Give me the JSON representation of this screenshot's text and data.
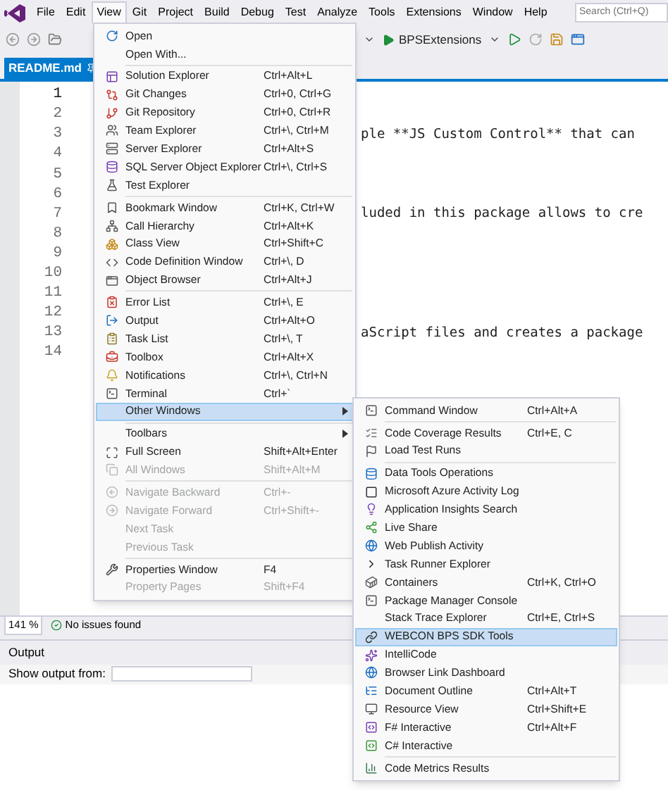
{
  "menu_bar": [
    {
      "label": "File",
      "selected": false
    },
    {
      "label": "Edit",
      "selected": false
    },
    {
      "label": "View",
      "selected": true
    },
    {
      "label": "Git",
      "selected": false
    },
    {
      "label": "Project",
      "selected": false
    },
    {
      "label": "Build",
      "selected": false
    },
    {
      "label": "Debug",
      "selected": false
    },
    {
      "label": "Test",
      "selected": false
    },
    {
      "label": "Analyze",
      "selected": false
    },
    {
      "label": "Tools",
      "selected": false
    },
    {
      "label": "Extensions",
      "selected": false
    },
    {
      "label": "Window",
      "selected": false
    },
    {
      "label": "Help",
      "selected": false
    }
  ],
  "search": {
    "placeholder": "Search (Ctrl+Q)"
  },
  "toolbar": {
    "run_target": "BPSExtensions"
  },
  "tab": {
    "title": "README.md",
    "selected": true
  },
  "editor": {
    "lines": [
      {
        "number": "1",
        "current": true
      },
      {
        "number": "2",
        "current": false
      },
      {
        "number": "3",
        "current": false,
        "text": "ple **JS Custom Control** that can"
      },
      {
        "number": "4",
        "current": false
      },
      {
        "number": "5",
        "current": false
      },
      {
        "number": "6",
        "current": false
      },
      {
        "number": "7",
        "current": false,
        "text": "luded in this package allows to cre"
      },
      {
        "number": "8",
        "current": false
      },
      {
        "number": "9",
        "current": false
      },
      {
        "number": "10",
        "current": false
      },
      {
        "number": "11",
        "current": false
      },
      {
        "number": "12",
        "current": false
      },
      {
        "number": "13",
        "current": false,
        "text": "aScript files and creates a package"
      },
      {
        "number": "14",
        "current": false
      }
    ]
  },
  "status_bar": {
    "zoom": "141 %",
    "issues": "No issues found"
  },
  "output_panel": {
    "title": "Output",
    "show_output_label": "Show output from:"
  },
  "view_menu": [
    {
      "kind": "item",
      "label": "Open",
      "has_icon": true,
      "disabled": false,
      "selected": false,
      "submenu": false
    },
    {
      "kind": "item",
      "label": "Open With...",
      "has_icon": false,
      "disabled": false,
      "selected": false,
      "submenu": false
    },
    {
      "kind": "separator"
    },
    {
      "kind": "item",
      "label": "Solution Explorer",
      "shortcut": "Ctrl+Alt+L",
      "has_icon": true,
      "disabled": false,
      "selected": false,
      "submenu": false
    },
    {
      "kind": "item",
      "label": "Git Changes",
      "shortcut": "Ctrl+0, Ctrl+G",
      "has_icon": true,
      "disabled": false,
      "selected": false,
      "submenu": false
    },
    {
      "kind": "item",
      "label": "Git Repository",
      "shortcut": "Ctrl+0, Ctrl+R",
      "has_icon": true,
      "disabled": false,
      "selected": false,
      "submenu": false
    },
    {
      "kind": "item",
      "label": "Team Explorer",
      "shortcut": "Ctrl+\\, Ctrl+M",
      "has_icon": true,
      "disabled": false,
      "selected": false,
      "submenu": false
    },
    {
      "kind": "item",
      "label": "Server Explorer",
      "shortcut": "Ctrl+Alt+S",
      "has_icon": true,
      "disabled": false,
      "selected": false,
      "submenu": false
    },
    {
      "kind": "item",
      "label": "SQL Server Object Explorer",
      "shortcut": "Ctrl+\\, Ctrl+S",
      "has_icon": true,
      "disabled": false,
      "selected": false,
      "submenu": false
    },
    {
      "kind": "item",
      "label": "Test Explorer",
      "has_icon": true,
      "disabled": false,
      "selected": false,
      "submenu": false
    },
    {
      "kind": "separator"
    },
    {
      "kind": "item",
      "label": "Bookmark Window",
      "shortcut": "Ctrl+K, Ctrl+W",
      "has_icon": true,
      "disabled": false,
      "selected": false,
      "submenu": false
    },
    {
      "kind": "item",
      "label": "Call Hierarchy",
      "shortcut": "Ctrl+Alt+K",
      "has_icon": true,
      "disabled": false,
      "selected": false,
      "submenu": false
    },
    {
      "kind": "item",
      "label": "Class View",
      "shortcut": "Ctrl+Shift+C",
      "has_icon": true,
      "disabled": false,
      "selected": false,
      "submenu": false
    },
    {
      "kind": "item",
      "label": "Code Definition Window",
      "shortcut": "Ctrl+\\, D",
      "has_icon": true,
      "disabled": false,
      "selected": false,
      "submenu": false
    },
    {
      "kind": "item",
      "label": "Object Browser",
      "shortcut": "Ctrl+Alt+J",
      "has_icon": true,
      "disabled": false,
      "selected": false,
      "submenu": false
    },
    {
      "kind": "separator"
    },
    {
      "kind": "item",
      "label": "Error List",
      "shortcut": "Ctrl+\\, E",
      "has_icon": true,
      "disabled": false,
      "selected": false,
      "submenu": false
    },
    {
      "kind": "item",
      "label": "Output",
      "shortcut": "Ctrl+Alt+O",
      "has_icon": true,
      "disabled": false,
      "selected": false,
      "submenu": false
    },
    {
      "kind": "item",
      "label": "Task List",
      "shortcut": "Ctrl+\\, T",
      "has_icon": true,
      "disabled": false,
      "selected": false,
      "submenu": false
    },
    {
      "kind": "item",
      "label": "Toolbox",
      "shortcut": "Ctrl+Alt+X",
      "has_icon": true,
      "disabled": false,
      "selected": false,
      "submenu": false
    },
    {
      "kind": "item",
      "label": "Notifications",
      "shortcut": "Ctrl+\\, Ctrl+N",
      "has_icon": true,
      "disabled": false,
      "selected": false,
      "submenu": false
    },
    {
      "kind": "item",
      "label": "Terminal",
      "shortcut": "Ctrl+`",
      "has_icon": true,
      "disabled": false,
      "selected": false,
      "submenu": false
    },
    {
      "kind": "item",
      "label": "Other Windows",
      "has_icon": false,
      "disabled": false,
      "selected": true,
      "submenu": true
    },
    {
      "kind": "separator"
    },
    {
      "kind": "item",
      "label": "Toolbars",
      "has_icon": false,
      "disabled": false,
      "selected": false,
      "submenu": true
    },
    {
      "kind": "item",
      "label": "Full Screen",
      "shortcut": "Shift+Alt+Enter",
      "has_icon": true,
      "disabled": false,
      "selected": false,
      "submenu": false
    },
    {
      "kind": "item",
      "label": "All Windows",
      "shortcut": "Shift+Alt+M",
      "has_icon": true,
      "disabled": true,
      "selected": false,
      "submenu": false
    },
    {
      "kind": "separator"
    },
    {
      "kind": "item",
      "label": "Navigate Backward",
      "shortcut": "Ctrl+-",
      "has_icon": true,
      "disabled": true,
      "selected": false,
      "submenu": false
    },
    {
      "kind": "item",
      "label": "Navigate Forward",
      "shortcut": "Ctrl+Shift+-",
      "has_icon": true,
      "disabled": true,
      "selected": false,
      "submenu": false
    },
    {
      "kind": "item",
      "label": "Next Task",
      "has_icon": false,
      "disabled": true,
      "selected": false,
      "submenu": false
    },
    {
      "kind": "item",
      "label": "Previous Task",
      "has_icon": false,
      "disabled": true,
      "selected": false,
      "submenu": false
    },
    {
      "kind": "separator"
    },
    {
      "kind": "item",
      "label": "Properties Window",
      "shortcut": "F4",
      "has_icon": true,
      "disabled": false,
      "selected": false,
      "submenu": false
    },
    {
      "kind": "item",
      "label": "Property Pages",
      "shortcut": "Shift+F4",
      "has_icon": false,
      "disabled": true,
      "selected": false,
      "submenu": false
    }
  ],
  "other_windows_menu": [
    {
      "kind": "item",
      "label": "Command Window",
      "shortcut": "Ctrl+Alt+A",
      "has_icon": true,
      "disabled": false,
      "selected": false,
      "submenu": false
    },
    {
      "kind": "separator"
    },
    {
      "kind": "item",
      "label": "Code Coverage Results",
      "shortcut": "Ctrl+E, C",
      "has_icon": true,
      "disabled": false,
      "selected": false,
      "submenu": false
    },
    {
      "kind": "item",
      "label": "Load Test Runs",
      "has_icon": true,
      "disabled": false,
      "selected": false,
      "submenu": false
    },
    {
      "kind": "separator"
    },
    {
      "kind": "item",
      "label": "Data Tools Operations",
      "has_icon": true,
      "disabled": false,
      "selected": false,
      "submenu": false
    },
    {
      "kind": "item",
      "label": "Microsoft Azure Activity Log",
      "has_icon": true,
      "disabled": false,
      "selected": false,
      "submenu": false
    },
    {
      "kind": "item",
      "label": "Application Insights Search",
      "has_icon": true,
      "disabled": false,
      "selected": false,
      "submenu": false
    },
    {
      "kind": "item",
      "label": "Live Share",
      "has_icon": true,
      "disabled": false,
      "selected": false,
      "submenu": false
    },
    {
      "kind": "item",
      "label": "Web Publish Activity",
      "has_icon": true,
      "disabled": false,
      "selected": false,
      "submenu": false
    },
    {
      "kind": "item",
      "label": "Task Runner Explorer",
      "has_icon": true,
      "disabled": false,
      "selected": false,
      "submenu": false
    },
    {
      "kind": "item",
      "label": "Containers",
      "shortcut": "Ctrl+K, Ctrl+O",
      "has_icon": true,
      "disabled": false,
      "selected": false,
      "submenu": false
    },
    {
      "kind": "item",
      "label": "Package Manager Console",
      "has_icon": true,
      "disabled": false,
      "selected": false,
      "submenu": false
    },
    {
      "kind": "item",
      "label": "Stack Trace Explorer",
      "shortcut": "Ctrl+E, Ctrl+S",
      "has_icon": false,
      "disabled": false,
      "selected": false,
      "submenu": false
    },
    {
      "kind": "item",
      "label": "WEBCON BPS SDK Tools",
      "has_icon": true,
      "disabled": false,
      "selected": true,
      "submenu": false
    },
    {
      "kind": "item",
      "label": "IntelliCode",
      "has_icon": true,
      "disabled": false,
      "selected": false,
      "submenu": false
    },
    {
      "kind": "item",
      "label": "Browser Link Dashboard",
      "has_icon": true,
      "disabled": false,
      "selected": false,
      "submenu": false
    },
    {
      "kind": "item",
      "label": "Document Outline",
      "shortcut": "Ctrl+Alt+T",
      "has_icon": true,
      "disabled": false,
      "selected": false,
      "submenu": false
    },
    {
      "kind": "item",
      "label": "Resource View",
      "shortcut": "Ctrl+Shift+E",
      "has_icon": true,
      "disabled": false,
      "selected": false,
      "submenu": false
    },
    {
      "kind": "item",
      "label": "F# Interactive",
      "shortcut": "Ctrl+Alt+F",
      "has_icon": true,
      "disabled": false,
      "selected": false,
      "submenu": false
    },
    {
      "kind": "item",
      "label": "C# Interactive",
      "has_icon": true,
      "disabled": false,
      "selected": false,
      "submenu": false
    },
    {
      "kind": "separator"
    },
    {
      "kind": "item",
      "label": "Code Metrics Results",
      "has_icon": true,
      "disabled": false,
      "selected": false,
      "submenu": false
    }
  ]
}
